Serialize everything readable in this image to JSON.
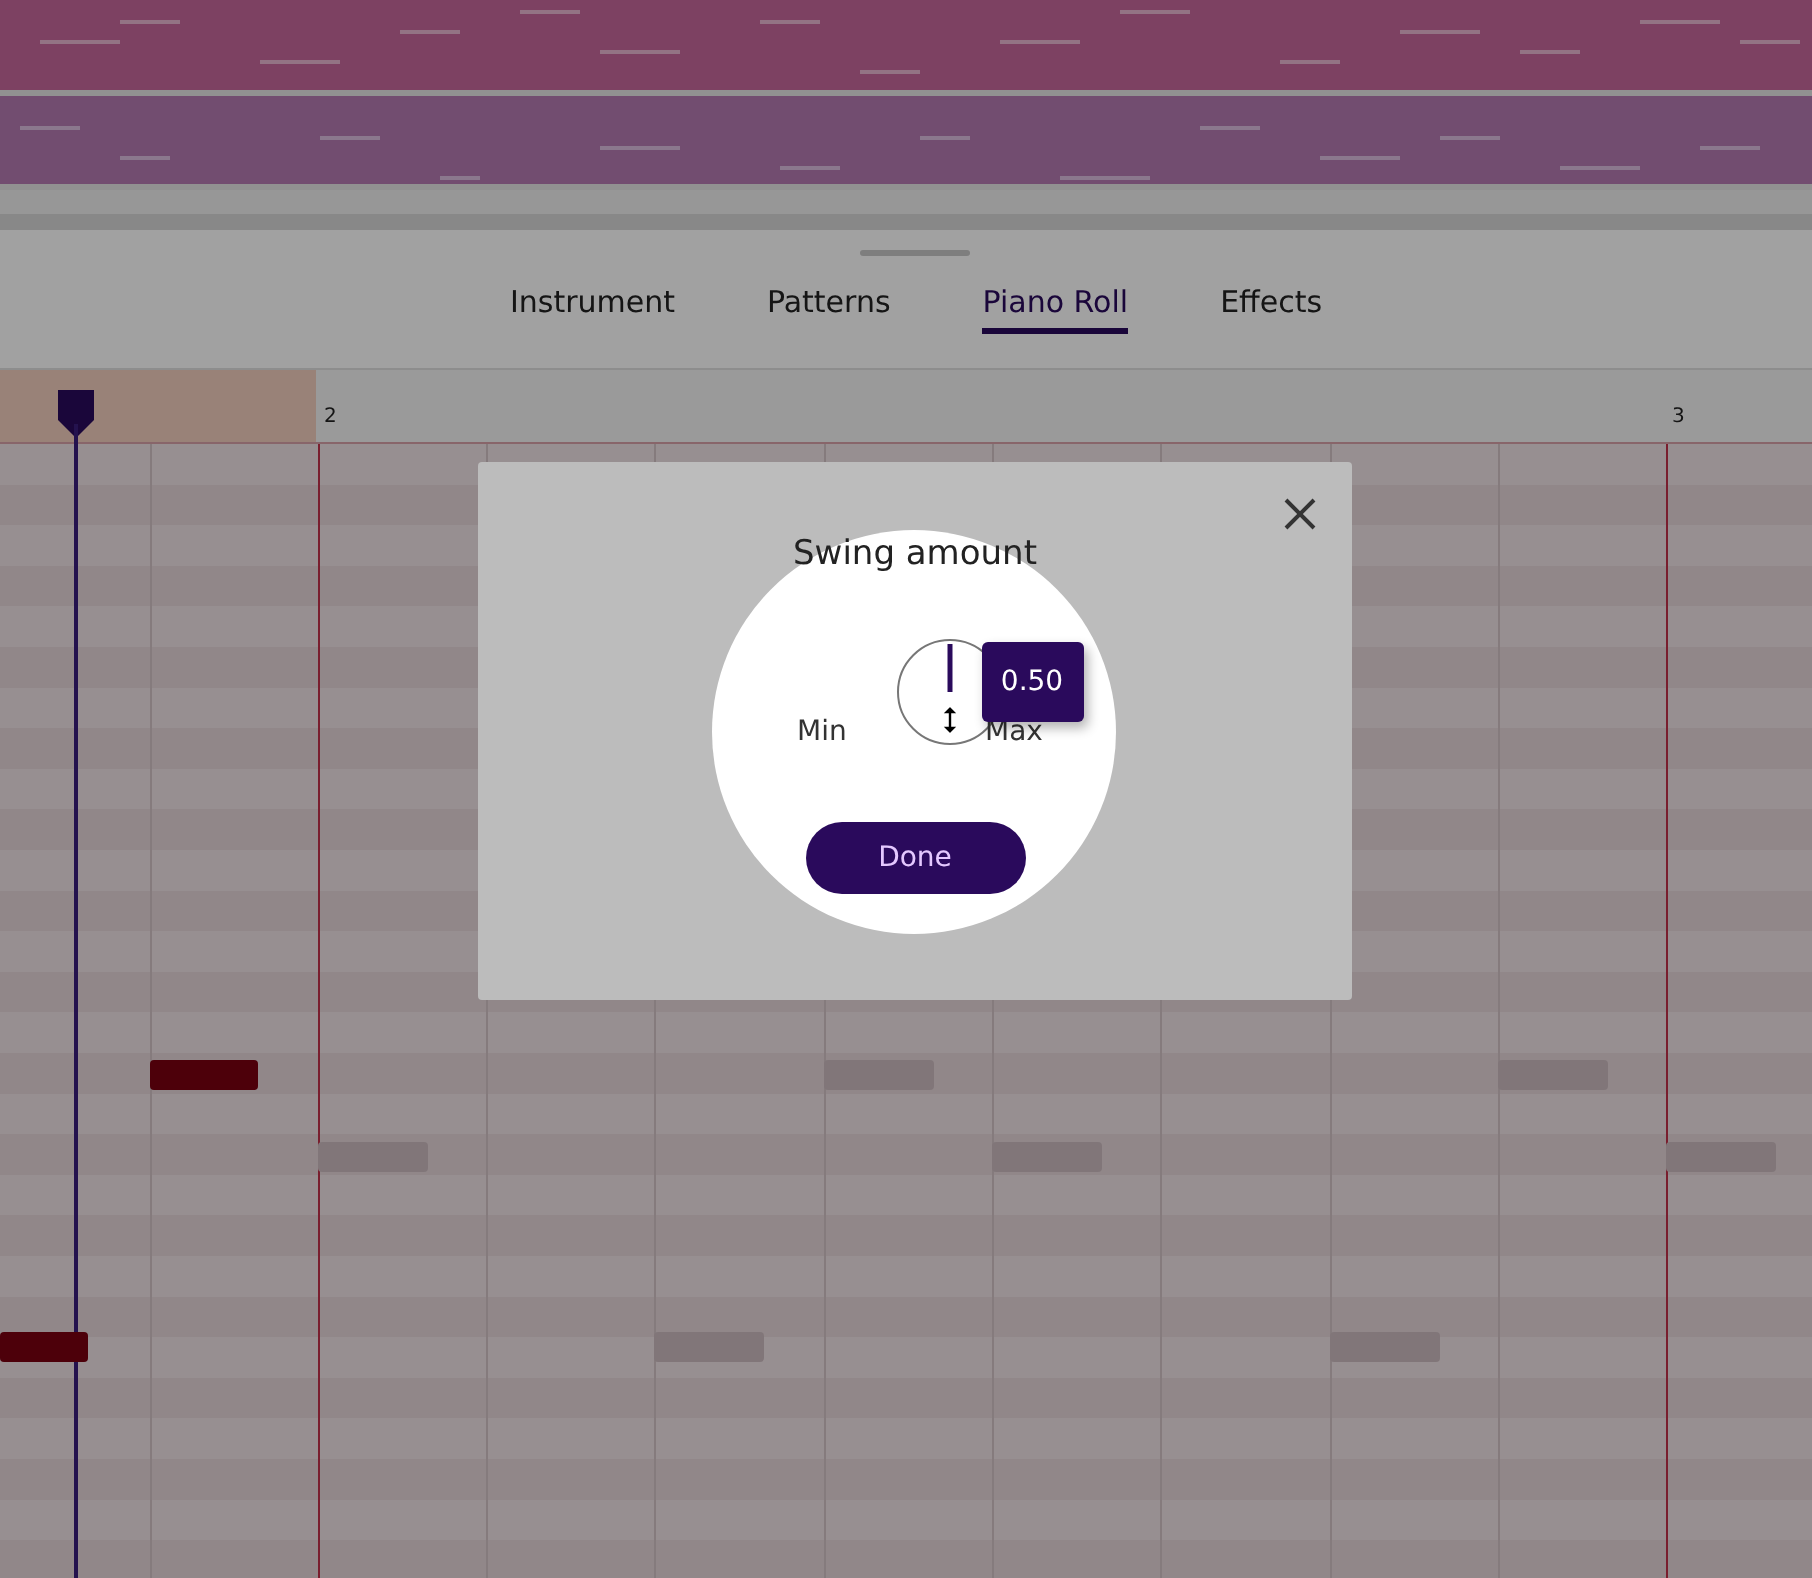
{
  "tabs": [
    {
      "label": "Instrument",
      "selected": false
    },
    {
      "label": "Patterns",
      "selected": false
    },
    {
      "label": "Piano Roll",
      "selected": true
    },
    {
      "label": "Effects",
      "selected": false
    }
  ],
  "ruler": {
    "bar_labels": [
      "2",
      "3"
    ]
  },
  "notes": [
    {
      "selected": true
    },
    {
      "selected": true
    },
    {
      "selected": false
    },
    {
      "selected": false
    },
    {
      "selected": false
    },
    {
      "selected": false
    },
    {
      "selected": false
    },
    {
      "selected": false
    },
    {
      "selected": false
    }
  ],
  "dialog": {
    "title": "Swing amount",
    "knob": {
      "level": 0.5,
      "min_label": "Min",
      "max_label": "Max",
      "value": "0.50"
    },
    "button": "Done"
  }
}
